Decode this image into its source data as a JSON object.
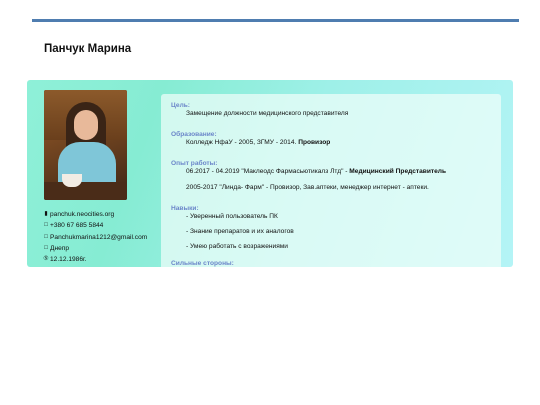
{
  "header": {
    "name": "Панчук Марина",
    "accent_color": "#4f7db0"
  },
  "contacts": [
    {
      "icon": "phone-icon",
      "glyph": "▮",
      "text": "panchuk.neocities.org"
    },
    {
      "icon": "phone-icon",
      "glyph": "□",
      "text": "+380 67 685 5844"
    },
    {
      "icon": "mail-icon",
      "glyph": "□",
      "text": "Panchukmarina1212@gmail.com"
    },
    {
      "icon": "location-icon",
      "glyph": "□",
      "text": "Днепр"
    },
    {
      "icon": "calendar-icon",
      "glyph": "⑤",
      "text": "12.12.1986г."
    }
  ],
  "resume": {
    "goal_label": "Цель:",
    "goal_text": "Замещение должности медицинского представителя",
    "education_label": "Образование:",
    "education_text": "Колледж НфаУ - 2005, ЗГМУ - 2014.",
    "education_bold": "Провизор",
    "experience_label": "Опыт работы:",
    "experience_1_text": "06.2017 - 04.2019 \"Маклеодс Фармасьютикалз Лтд\" -",
    "experience_1_bold": "Медицинский Представитель",
    "experience_2_text": "2005-2017 \"Линда- Фарм\" - Провизор, Зав.аптеки, менеджер интернет - аптеки.",
    "skills_label": "Навыки:",
    "skills": [
      "- Уверенный пользователь ПК",
      "- Знание препаратов и их аналогов",
      "- Умею работать с возражениями"
    ],
    "strengths_label": "Сильные стороны:"
  }
}
